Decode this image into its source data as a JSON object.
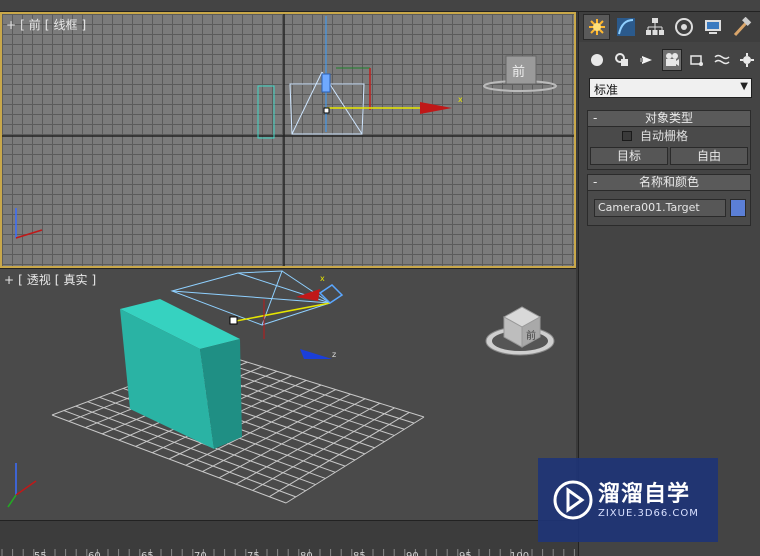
{
  "viewports": {
    "front": {
      "plus": "+",
      "bracket1": "[",
      "view": "前",
      "bracket2": "[",
      "shading": "线框",
      "bracket3": "]"
    },
    "perspective": {
      "plus": "+",
      "bracket1": "[",
      "view": "透视",
      "bracket2": "[",
      "shading": "真实",
      "bracket3": "]"
    },
    "viewcube_front_label": "前",
    "viewcube_persp_label": "前",
    "gizmo_front_axis_label": "x",
    "gizmo_persp_x_label": "x",
    "gizmo_persp_z_label": "z"
  },
  "timeline": {
    "ticks": [
      "55",
      "60",
      "65",
      "70",
      "75",
      "80",
      "85",
      "90",
      "95",
      "100"
    ]
  },
  "command_panel": {
    "tabs": [
      "create-icon",
      "modify-icon",
      "hierarchy-icon",
      "motion-icon",
      "display-icon",
      "utilities-icon"
    ],
    "subtabs": [
      "geometry-icon",
      "shapes-icon",
      "lights-icon",
      "cameras-icon",
      "helpers-icon",
      "spacewarps-icon",
      "systems-icon"
    ],
    "dropdown_value": "标准",
    "object_type": {
      "minus": "-",
      "title": "对象类型",
      "autogrid_label": "自动栅格",
      "buttons": [
        "目标",
        "自由"
      ]
    },
    "name_color": {
      "minus": "-",
      "title": "名称和颜色",
      "name_value": "Camera001.Target",
      "color": "#5b7fd6"
    }
  },
  "watermark": {
    "title": "溜溜自学",
    "url": "ZIXUE.3D66.COM"
  },
  "colors": {
    "active_border": "#c9a84a",
    "grid_bg": "#7b7b7b",
    "box": "#2fbfae"
  }
}
